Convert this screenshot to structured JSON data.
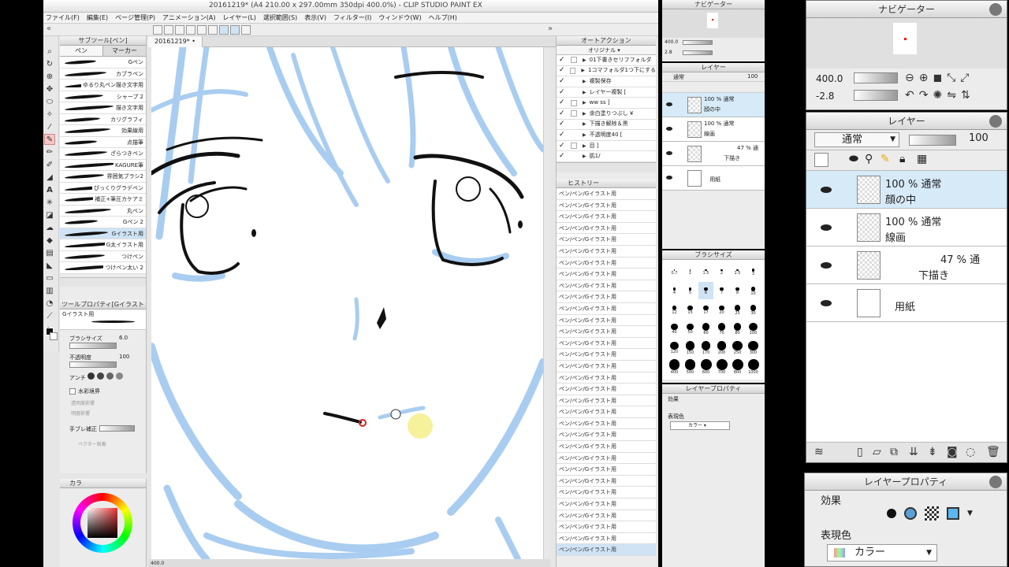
{
  "window": {
    "title": "20161219* (A4 210.00 x 297.00mm 350dpi 400.0%) - CLIP STUDIO PAINT EX"
  },
  "menu": [
    "ファイル(F)",
    "編集(E)",
    "ページ管理(P)",
    "アニメーション(A)",
    "レイヤー(L)",
    "選択範囲(S)",
    "表示(V)",
    "フィルター(I)",
    "ウィンドウ(W)",
    "ヘルプ(H)"
  ],
  "canvas_tab": {
    "label": "20161219*"
  },
  "subtool": {
    "header": "サブツール[ペン]",
    "tabs": [
      "ペン",
      "マーカー"
    ],
    "brushes": [
      {
        "label": "Gペン"
      },
      {
        "label": "カブラペン"
      },
      {
        "label": "ゆるり丸ペン描き文字用"
      },
      {
        "label": "シャープ 2"
      },
      {
        "label": "描き文字用"
      },
      {
        "label": "カリグラフィ"
      },
      {
        "label": "効果線用"
      },
      {
        "label": "点描筆"
      },
      {
        "label": "ざらつきペン"
      },
      {
        "label": "KAGURE筆"
      },
      {
        "label": "雰囲気ブラシ2"
      },
      {
        "label": "ぴっくりグラデペン"
      },
      {
        "label": "補正+筆圧カケアミ"
      },
      {
        "label": "丸ペン"
      },
      {
        "label": "Gペン 2"
      },
      {
        "label": "Gイラスト用",
        "selected": true
      },
      {
        "label": "G太イラスト用"
      },
      {
        "label": "つけペン"
      },
      {
        "label": "つけペン太い 2"
      }
    ]
  },
  "tool_property": {
    "header": "ツールプロパティ[Gイラスト",
    "brush_name": "Gイラスト用",
    "brush_size_label": "ブラシサイズ",
    "brush_size_value": "6.0",
    "opacity_label": "不透明度",
    "opacity_value": "100",
    "antialias_label": "アンチ",
    "watercolor_label": "水彩境界",
    "transparency_label": "透明度影響",
    "brightness_label": "明度影響",
    "stabilization_label": "手ブレ補正",
    "vector_label": "ベクター吸着"
  },
  "color_panel": {
    "tab_label": "カラ"
  },
  "auto_action": {
    "header": "オートアクション",
    "set": "オリジナル",
    "items": [
      {
        "label": "01下書きセリフフォルダ",
        "box": true
      },
      {
        "label": "1コマフォルダ1つ下にする",
        "box": true
      },
      {
        "label": "複製保存",
        "box": false
      },
      {
        "label": "レイヤー複製 [",
        "box": false
      },
      {
        "label": "ww ss ]",
        "box": true
      },
      {
        "label": "余白塗りつぶし ¥",
        "box": true
      },
      {
        "label": "下描き解除＆黒",
        "box": false
      },
      {
        "label": "不透明度40 [",
        "box": false
      },
      {
        "label": "目 ]",
        "box": true
      },
      {
        "label": "肌1/",
        "box": false
      }
    ]
  },
  "history": {
    "header": "ヒストリー",
    "item_label": "ペン/ペン/Gイラスト用",
    "count": 32
  },
  "navigator_small": {
    "header": "ナビゲーター",
    "zoom": "400.0",
    "angle": "2.8"
  },
  "layers_small": {
    "header": "レイヤー",
    "blend": "通常",
    "opacity": "100",
    "layers": [
      {
        "pct": "100 %",
        "mode": "通常",
        "name": "顔の中",
        "selected": true
      },
      {
        "pct": "100 %",
        "mode": "通常",
        "name": "線画"
      },
      {
        "pct": "47 %",
        "mode": "通",
        "name": "下描き"
      },
      {
        "pct": "",
        "mode": "",
        "name": "用紙"
      }
    ]
  },
  "brush_size_panel": {
    "header": "ブラシサイズ",
    "sizes": [
      "0.7",
      "1",
      "1.5",
      "2",
      "2.5",
      "3",
      "4",
      "5",
      "6",
      "7",
      "8",
      "10",
      "12",
      "15",
      "17",
      "20",
      "25",
      "30",
      "40",
      "50",
      "60",
      "70",
      "80",
      "100",
      "120",
      "150",
      "170",
      "200",
      "250",
      "300",
      "400",
      "500",
      "600",
      "700",
      "800",
      "1000"
    ],
    "selected": "6"
  },
  "layer_prop_small": {
    "header": "レイヤープロパティ",
    "effect_label": "効果",
    "color_label": "表現色",
    "color_value": "カラー"
  },
  "navigator_big": {
    "header": "ナビゲーター",
    "zoom": "400.0",
    "angle": "-2.8"
  },
  "layers_big": {
    "header": "レイヤー",
    "blend": "通常",
    "opacity": "100",
    "layers": [
      {
        "pct": "100 %",
        "mode": "通常",
        "name": "顔の中",
        "selected": true
      },
      {
        "pct": "100 %",
        "mode": "通常",
        "name": "線画"
      },
      {
        "pct": "47 %",
        "mode": "通",
        "name": "下描き"
      },
      {
        "pct": "",
        "mode": "",
        "name": "用紙"
      }
    ]
  },
  "layer_prop_big": {
    "header": "レイヤープロパティ",
    "effect_label": "効果",
    "color_label": "表現色",
    "color_value": "カラー"
  },
  "status": {
    "zoom": "400.0"
  },
  "colors": {
    "sketch": "#a9cdf0",
    "ink": "#111111",
    "accent": "#5a9fd6",
    "cursor": "#f5ef8a"
  }
}
